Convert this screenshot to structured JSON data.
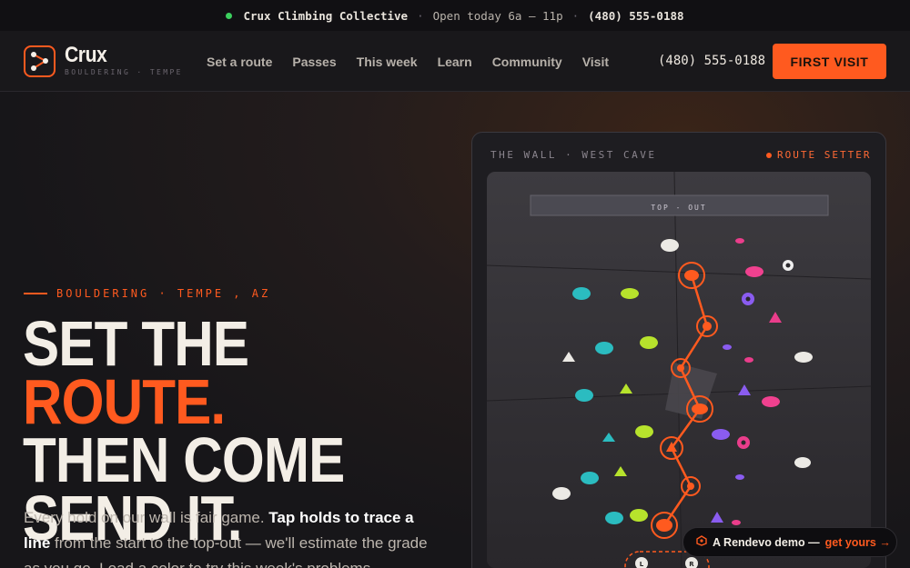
{
  "topbar": {
    "brand": "Crux Climbing Collective",
    "separator": "·",
    "hours": "Open today 6a – 11p",
    "phone": "(480) 555-0188",
    "status_color": "#3ccf5e"
  },
  "nav": {
    "logo_name": "Crux",
    "logo_tag": "BOULDERING · TEMPE",
    "links": [
      "Set a route",
      "Passes",
      "This week",
      "Learn",
      "Community",
      "Visit"
    ],
    "phone": "(480) 555-0188",
    "cta_label": "FIRST VISIT",
    "accent_color": "#ff5a1f"
  },
  "hero": {
    "eyebrow": "BOULDERING · TEMPE , AZ",
    "headline_part1": "SET THE ",
    "headline_accent": "ROUTE.",
    "headline_part2": "THEN COME SEND IT.",
    "lead_part1": "Every hold on our wall is fair game. ",
    "lead_bold": "Tap holds to trace a line",
    "lead_part2": " from the start to the top-out — we'll estimate the grade as you go. Load a color to try this week's problems."
  },
  "wall": {
    "label": "THE WALL · WEST CAVE",
    "setter_label": "ROUTE SETTER",
    "topout_label": "TOP - OUT",
    "start_left": "L",
    "start_right": "R",
    "route_color": "#ff5a1f"
  },
  "demo_badge": {
    "text": "A Rendevo demo —",
    "link": "get yours →"
  }
}
